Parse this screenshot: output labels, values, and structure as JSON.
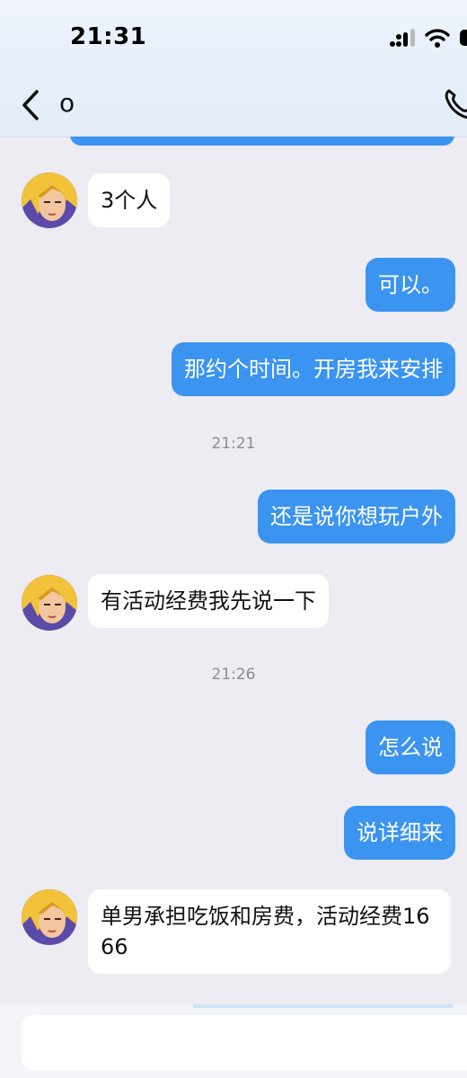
{
  "status_bar": {
    "time": "21:31"
  },
  "header": {
    "title": "o"
  },
  "icons": {
    "back": "chevron-left-icon",
    "call": "phone-icon",
    "signal": "cellular-signal-icon",
    "wifi": "wifi-icon",
    "battery": "battery-icon"
  },
  "colors": {
    "outgoing_bubble": "#3b94ef",
    "incoming_bubble": "#ffffff",
    "background": "#ececf2"
  },
  "messages": [
    {
      "dir": "in",
      "text": "3个人"
    },
    {
      "dir": "out",
      "text": "可以。"
    },
    {
      "dir": "out",
      "text": "那约个时间。开房我来安排"
    },
    {
      "type": "time",
      "text": "21:21"
    },
    {
      "dir": "out",
      "text": "还是说你想玩户外"
    },
    {
      "dir": "in",
      "text": "有活动经费我先说一下"
    },
    {
      "type": "time",
      "text": "21:26"
    },
    {
      "dir": "out",
      "text": "怎么说"
    },
    {
      "dir": "out",
      "text": "说详细来"
    },
    {
      "dir": "in",
      "text": "单男承担吃饭和房费，活动经费1666"
    }
  ],
  "input": {
    "placeholder": ""
  }
}
